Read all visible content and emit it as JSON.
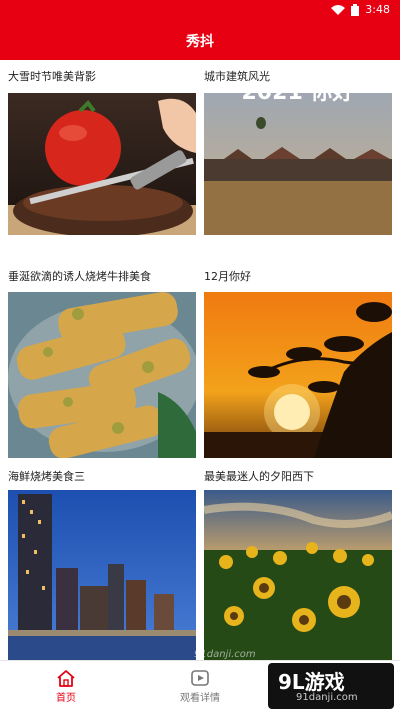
{
  "status_bar": {
    "time": "3:48"
  },
  "app_bar": {
    "title": "秀抖"
  },
  "feed": {
    "items": [
      {
        "title": "大雪时节唯美背影",
        "image": "steak-with-tomato"
      },
      {
        "title": "城市建筑风光",
        "image": "town-field-balloon",
        "overlay_text": "2021 你好"
      },
      {
        "title": "垂涎欲滴的诱人烧烤牛排美食",
        "image": "fried-fish-platter"
      },
      {
        "title": "12月你好",
        "image": "sunset-tree"
      },
      {
        "title": "海鲜烧烤美食三",
        "image": "city-night-skyline"
      },
      {
        "title": "最美最迷人的夕阳西下",
        "image": "sunflower-field"
      }
    ]
  },
  "bottom_nav": {
    "items": [
      {
        "label": "首页",
        "icon": "home-icon",
        "active": true
      },
      {
        "label": "观看详情",
        "icon": "play-icon",
        "active": false
      }
    ]
  },
  "watermark": {
    "logo": "9L游戏",
    "site": "91danji.com"
  },
  "colors": {
    "primary": "#e60012",
    "text": "#222222",
    "inactive": "#777777"
  }
}
